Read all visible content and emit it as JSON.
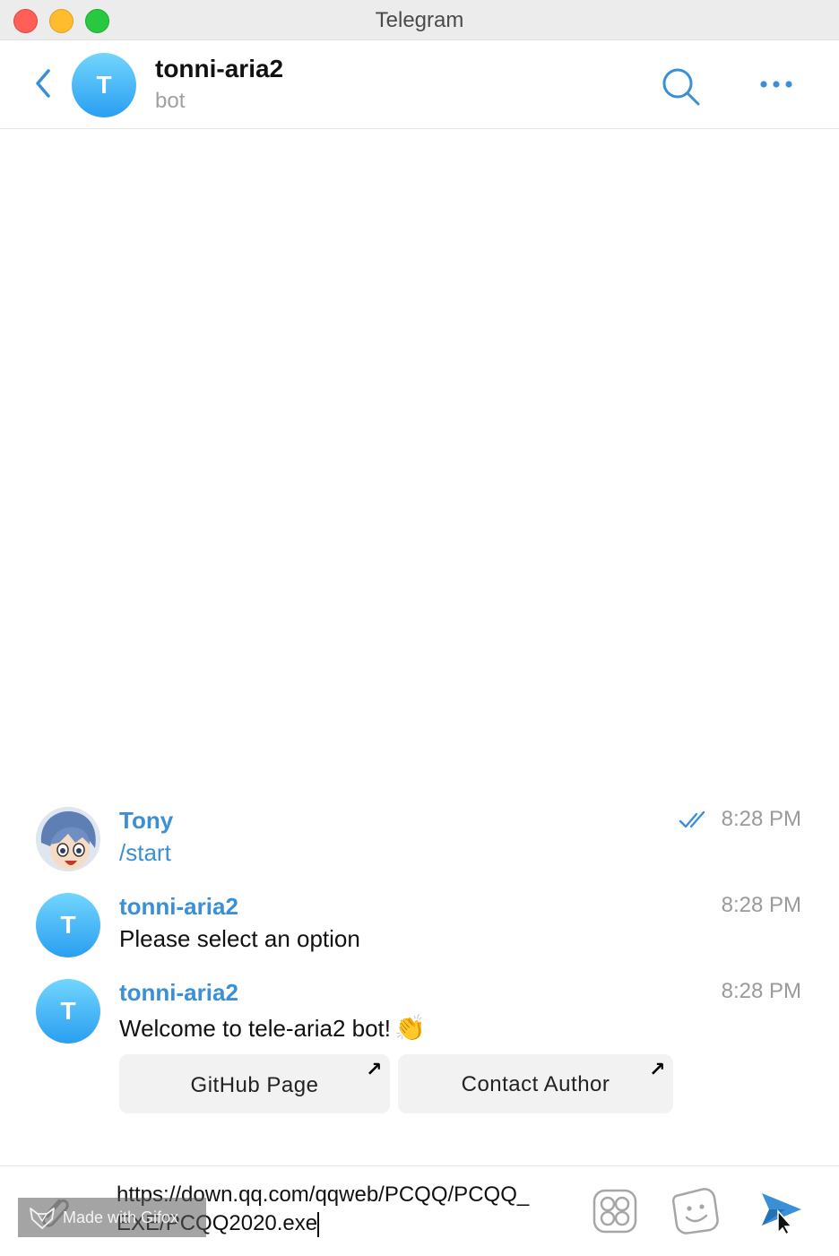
{
  "window": {
    "title": "Telegram"
  },
  "header": {
    "avatar_letter": "T",
    "name": "tonni-aria2",
    "subtitle": "bot"
  },
  "messages": [
    {
      "sender": "Tony",
      "text": "/start",
      "time": "8:28 PM",
      "read": true
    },
    {
      "sender": "tonni-aria2",
      "avatar_letter": "T",
      "text": "Please select an option",
      "time": "8:28 PM"
    },
    {
      "sender": "tonni-aria2",
      "avatar_letter": "T",
      "text": "Welcome to tele-aria2 bot!",
      "emoji": "👏",
      "time": "8:28 PM",
      "buttons": [
        {
          "label": "GitHub Page",
          "arrow": "↗"
        },
        {
          "label": "Contact Author",
          "arrow": "↗"
        }
      ]
    }
  ],
  "composer": {
    "value": "https://down.qq.com/qqweb/PCQQ/PCQQ_EXE/PCQQ2020.exe"
  },
  "watermark": {
    "text": "Made with Gifox"
  },
  "icons": [
    "back-icon",
    "search-icon",
    "more-icon",
    "double-check-icon",
    "paperclip-icon",
    "bot-commands-icon",
    "sticker-icon",
    "send-icon"
  ],
  "colors": {
    "accent": "#3a8fd6",
    "avatar_top": "#72d5fd",
    "avatar_bottom": "#2a9ef1",
    "time": "#9a9a9a"
  }
}
